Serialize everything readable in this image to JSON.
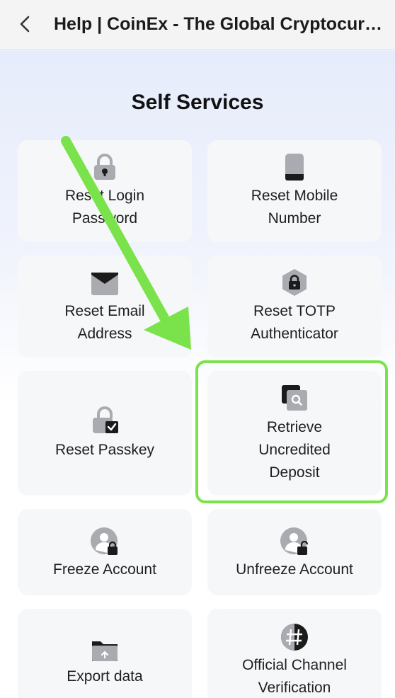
{
  "header": {
    "title": "Help | CoinEx - The Global Cryptocurrency Exchange",
    "back_icon": "chevron-left-icon"
  },
  "page": {
    "heading": "Self Services"
  },
  "services": [
    {
      "label": "Reset Login\nPassword",
      "icon": "lock-icon"
    },
    {
      "label": "Reset Mobile\nNumber",
      "icon": "mobile-phone-icon"
    },
    {
      "label": "Reset Email\nAddress",
      "icon": "envelope-icon"
    },
    {
      "label": "Reset TOTP\nAuthenticator",
      "icon": "hexagon-lock-icon"
    },
    {
      "label": "Reset Passkey",
      "icon": "lock-check-icon"
    },
    {
      "label": "Retrieve\nUncredited\nDeposit",
      "icon": "search-document-icon",
      "highlighted": true
    },
    {
      "label": "Freeze Account",
      "icon": "user-lock-icon"
    },
    {
      "label": "Unfreeze Account",
      "icon": "user-unlock-icon"
    },
    {
      "label": "Export data",
      "icon": "folder-upload-icon"
    },
    {
      "label": "Official Channel\nVerification",
      "icon": "hash-verify-icon"
    }
  ],
  "colors": {
    "highlight": "#7ae24a",
    "arrow": "#7ae24a",
    "icon_gray": "#a9abb1",
    "icon_dark": "#1b1b1b"
  }
}
